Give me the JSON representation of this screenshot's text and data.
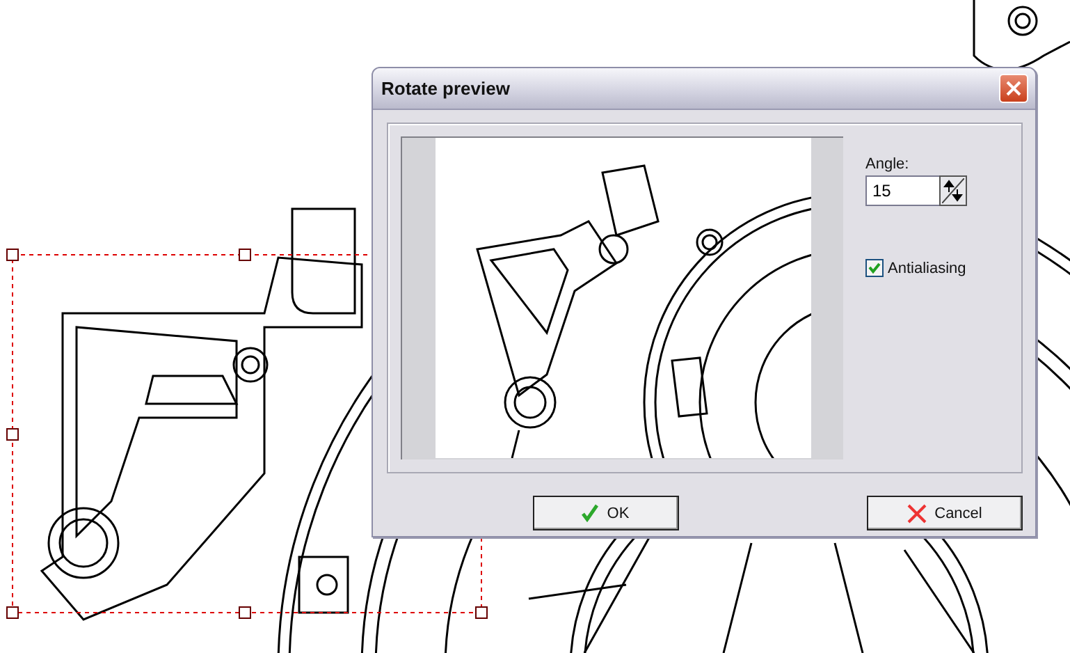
{
  "dialog": {
    "title": "Rotate preview",
    "angle_label": "Angle:",
    "angle_value": "15",
    "antialiasing": {
      "label": "Antialiasing",
      "checked": true
    },
    "buttons": [
      {
        "kind": "ok",
        "label": "OK"
      },
      {
        "kind": "cancel",
        "label": "Cancel"
      }
    ]
  }
}
